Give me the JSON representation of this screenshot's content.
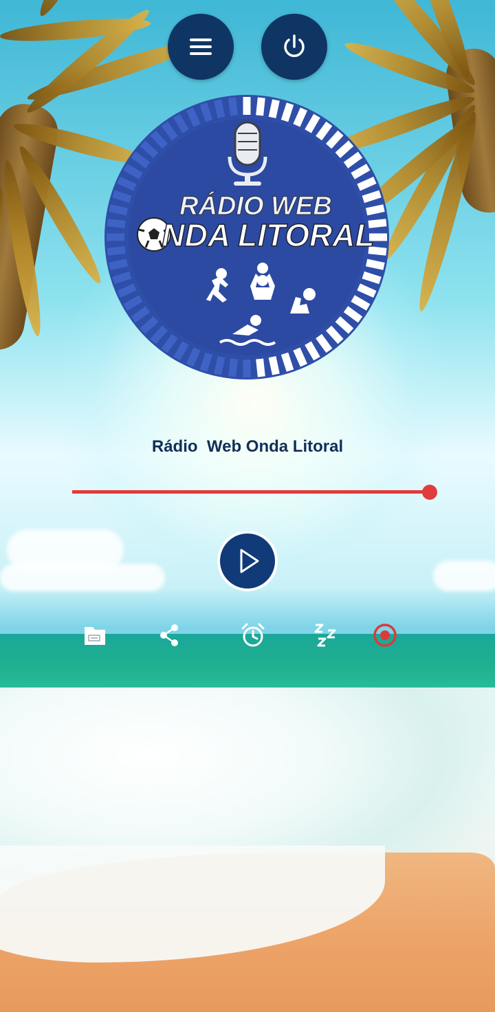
{
  "header": {
    "menu_icon": "menu-icon",
    "power_icon": "power-icon"
  },
  "logo": {
    "line1": "RÁDIO WEB",
    "line2": "NDA LITORAL",
    "icons": [
      "microphone-icon",
      "soccer-ball-icon",
      "runner-icon",
      "volleyball-icon",
      "waterpolo-icon",
      "swimmer-icon"
    ]
  },
  "player": {
    "station_name": "Rádio  Web Onda Litoral",
    "volume_fraction": 1.0,
    "play_icon": "play-icon"
  },
  "toolbar": {
    "items": [
      "folder-icon",
      "share-icon",
      "alarm-clock-icon",
      "sleep-timer-icon",
      "record-icon"
    ]
  },
  "colors": {
    "button_bg": "#0f3564",
    "accent_red": "#e23b3b",
    "logo_blue": "#2e4ea8",
    "title_text": "#0f2f57"
  }
}
